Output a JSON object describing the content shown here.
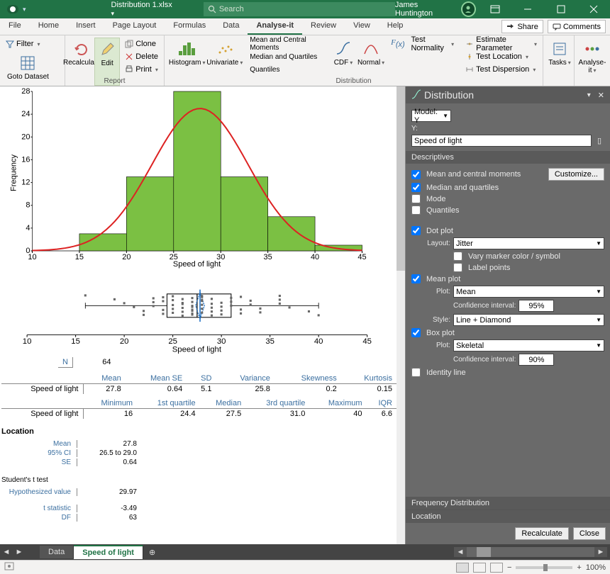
{
  "app": {
    "save_state": "",
    "filename": "Distribution 1.xlsx",
    "search_placeholder": "Search",
    "user": "James Huntington"
  },
  "tabs": {
    "items": [
      "File",
      "Home",
      "Insert",
      "Page Layout",
      "Formulas",
      "Data",
      "Analyse-it",
      "Review",
      "View",
      "Help"
    ],
    "active": "Analyse-it",
    "share": "Share",
    "comments": "Comments"
  },
  "ribbon": {
    "filter": "Filter",
    "goto": "Goto Dataset",
    "recalc": "Recalculate",
    "edit": "Edit",
    "clone": "Clone",
    "delete": "Delete",
    "print": "Print",
    "histogram": "Histogram",
    "univariate": "Univariate",
    "mcm": "Mean and Central Moments",
    "mq": "Median and Quartiles",
    "quant": "Quantiles",
    "cdf": "CDF",
    "normal": "Normal",
    "testnorm": "Test Normality",
    "estparam": "Estimate Parameter",
    "testloc": "Test Location",
    "testdisp": "Test Dispersion",
    "tasks": "Tasks",
    "analyseit": "Analyse-it",
    "grp_report": "Report",
    "grp_dist": "Distribution"
  },
  "panel": {
    "title": "Distribution",
    "model": "Model: Y",
    "y": "Y:",
    "yval": "Speed of light",
    "descriptives": "Descriptives",
    "mean_cm": "Mean and central moments",
    "customize": "Customize...",
    "med_q": "Median and quartiles",
    "mode": "Mode",
    "quantiles": "Quantiles",
    "dotplot": "Dot plot",
    "layout": "Layout:",
    "jitter": "Jitter",
    "vary": "Vary marker color / symbol",
    "labelpts": "Label points",
    "meanplot": "Mean plot",
    "plot": "Plot:",
    "mean": "Mean",
    "ci": "Confidence interval:",
    "ci95": "95%",
    "style": "Style:",
    "styleval": "Line + Diamond",
    "boxplot": "Box plot",
    "skeletal": "Skeletal",
    "ci90": "90%",
    "identity": "Identity line",
    "freqdist": "Frequency Distribution",
    "location": "Location",
    "recalc": "Recalculate",
    "close": "Close"
  },
  "stats": {
    "n_label": "N",
    "n": "64",
    "hdrs1": [
      "Mean",
      "Mean SE",
      "SD",
      "Variance",
      "Skewness",
      "Kurtosis"
    ],
    "rowlabel": "Speed of light",
    "vals1": [
      "27.8",
      "0.64",
      "5.1",
      "25.8",
      "0.2",
      "0.15"
    ],
    "hdrs2": [
      "Minimum",
      "1st quartile",
      "Median",
      "3rd quartile",
      "Maximum",
      "IQR"
    ],
    "vals2": [
      "16",
      "24.4",
      "27.5",
      "31.0",
      "40",
      "6.6"
    ]
  },
  "location": {
    "title": "Location",
    "mean_l": "Mean",
    "mean_v": "27.8",
    "ci_l": "95% CI",
    "ci_v": "26.5 to 29.0",
    "se_l": "SE",
    "se_v": "0.64",
    "ttest": "Student's t test",
    "hyp_l": "Hypothesized value",
    "hyp_v": "29.97",
    "t_l": "t statistic",
    "t_v": "-3.49",
    "df_l": "DF",
    "df_v": "63"
  },
  "sheettabs": {
    "items": [
      "Data",
      "Speed of light"
    ],
    "active": "Speed of light"
  },
  "statusbar": {
    "zoom": "100%"
  },
  "chart_data": {
    "histogram": {
      "type": "bar",
      "xlabel": "Speed of light",
      "ylabel": "Frequency",
      "xlim": [
        10,
        45
      ],
      "ylim": [
        0,
        28
      ],
      "yticks": [
        0,
        4,
        8,
        12,
        16,
        20,
        24,
        28
      ],
      "xticks": [
        10,
        15,
        20,
        25,
        30,
        35,
        40,
        45
      ],
      "bins": [
        {
          "x0": 15,
          "x1": 20,
          "count": 3
        },
        {
          "x0": 20,
          "x1": 25,
          "count": 13
        },
        {
          "x0": 25,
          "x1": 30,
          "count": 28
        },
        {
          "x0": 30,
          "x1": 35,
          "count": 13
        },
        {
          "x0": 35,
          "x1": 40,
          "count": 6
        },
        {
          "x0": 40,
          "x1": 45,
          "count": 1
        }
      ],
      "normal_curve": {
        "mean": 27.8,
        "sd": 5.1,
        "peak": 25
      }
    },
    "boxplot": {
      "type": "box",
      "xlabel": "Speed of light",
      "xlim": [
        10,
        45
      ],
      "xticks": [
        10,
        15,
        20,
        25,
        30,
        35,
        40,
        45
      ],
      "min": 16,
      "q1": 24.4,
      "median": 27.5,
      "q3": 31.0,
      "max": 40,
      "mean": 27.8
    }
  }
}
